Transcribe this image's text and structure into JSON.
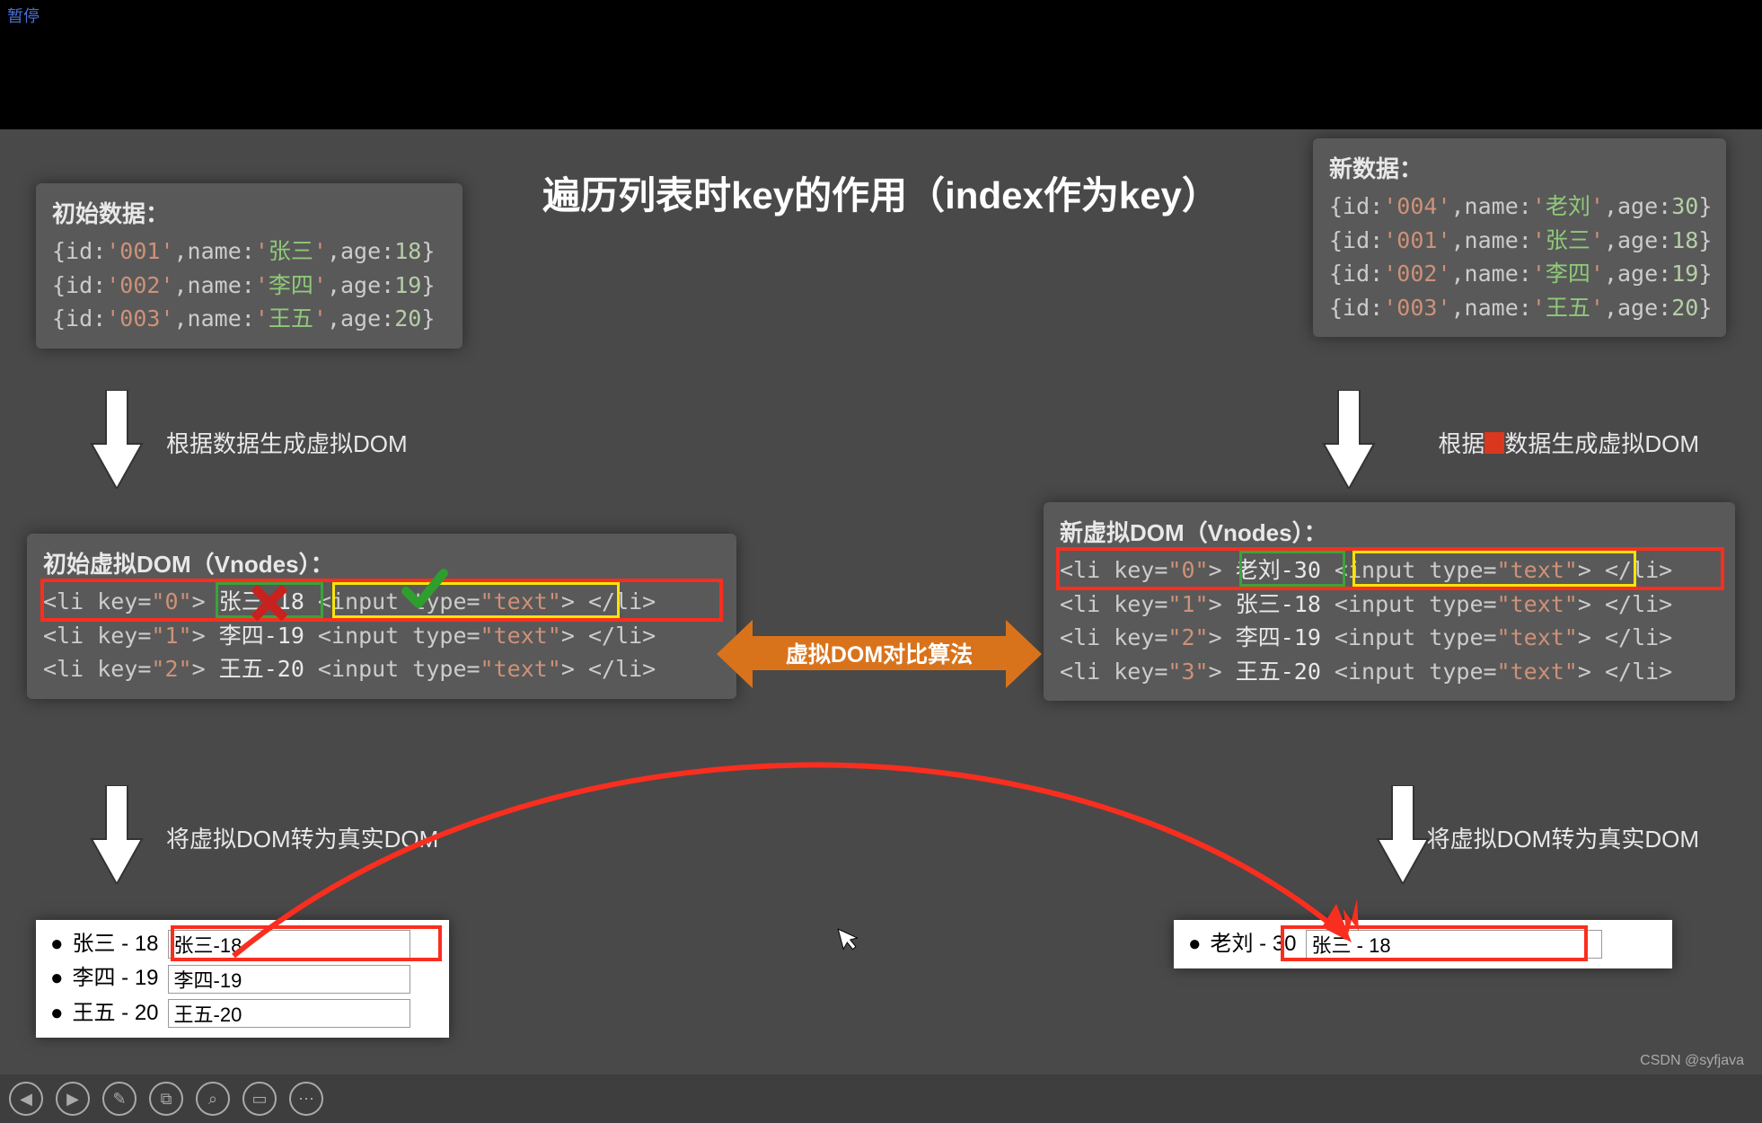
{
  "pause": "暂停",
  "title": "遍历列表时key的作用（index作为key）",
  "initial_data": {
    "title": "初始数据：",
    "rows": [
      {
        "id": "001",
        "name": "张三",
        "age": 18
      },
      {
        "id": "002",
        "name": "李四",
        "age": 19
      },
      {
        "id": "003",
        "name": "王五",
        "age": 20
      }
    ]
  },
  "new_data": {
    "title": "新数据：",
    "rows": [
      {
        "id": "004",
        "name": "老刘",
        "age": 30
      },
      {
        "id": "001",
        "name": "张三",
        "age": 18
      },
      {
        "id": "002",
        "name": "李四",
        "age": 19
      },
      {
        "id": "003",
        "name": "王五",
        "age": 20
      }
    ]
  },
  "captions": {
    "gen_vdom_left": "根据数据生成虚拟DOM",
    "gen_vdom_right_pre": "根据",
    "gen_vdom_right_post": "数据生成虚拟DOM",
    "to_real_dom": "将虚拟DOM转为真实DOM",
    "compare_algo": "虚拟DOM对比算法"
  },
  "initial_vnodes": {
    "title": "初始虚拟DOM（Vnodes）：",
    "items": [
      {
        "key": "0",
        "text": "张三-18"
      },
      {
        "key": "1",
        "text": "李四-19"
      },
      {
        "key": "2",
        "text": "王五-20"
      }
    ]
  },
  "new_vnodes": {
    "title": "新虚拟DOM（Vnodes）：",
    "items": [
      {
        "key": "0",
        "text": "老刘-30"
      },
      {
        "key": "1",
        "text": "张三-18"
      },
      {
        "key": "2",
        "text": "李四-19"
      },
      {
        "key": "3",
        "text": "王五-20"
      }
    ]
  },
  "dom_left": [
    {
      "label": "张三 - 18",
      "input": "张三-18"
    },
    {
      "label": "李四 - 19",
      "input": "李四-19"
    },
    {
      "label": "王五 - 20",
      "input": "王五-20"
    }
  ],
  "dom_right": [
    {
      "label": "老刘 - 30",
      "input": "张三 - 18"
    }
  ],
  "watermark": "CSDN @syfjava"
}
